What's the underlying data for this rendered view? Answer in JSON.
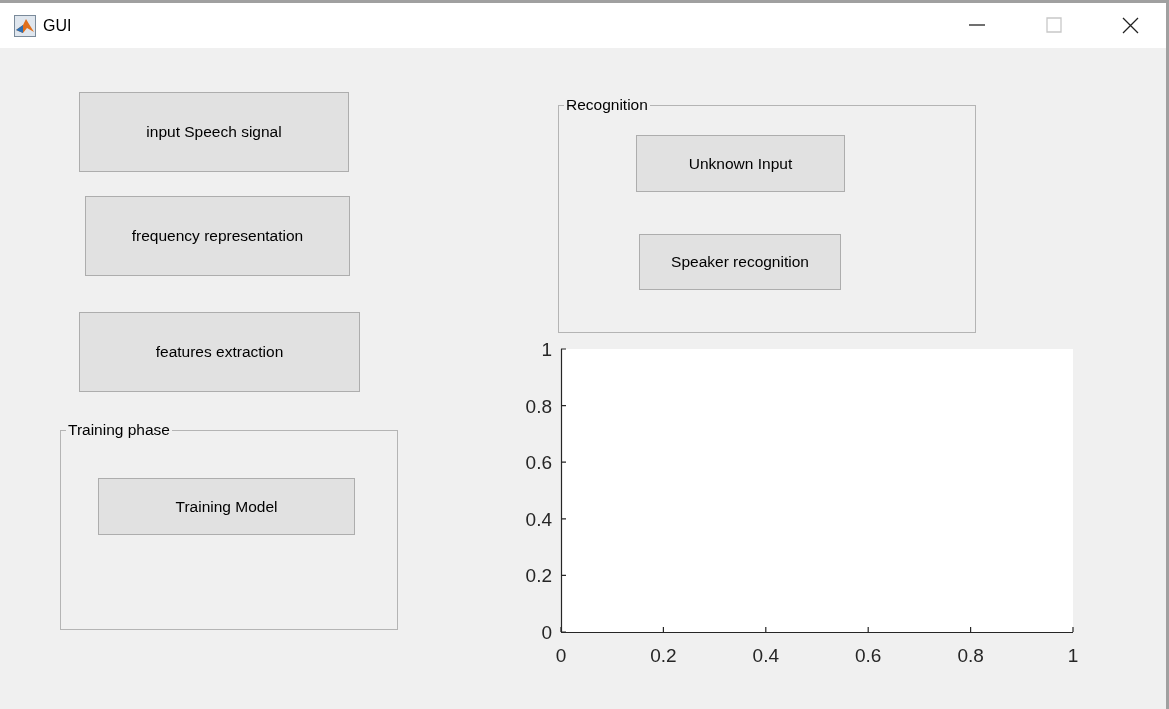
{
  "window": {
    "title": "GUI"
  },
  "buttons": [
    {
      "label": "input Speech signal"
    },
    {
      "label": "frequency representation"
    },
    {
      "label": "features extraction"
    }
  ],
  "panels": [
    {
      "title": "Training phase",
      "buttons": [
        {
          "label": "Training Model"
        }
      ]
    },
    {
      "title": "Recognition",
      "buttons": [
        {
          "label": "Unknown Input"
        },
        {
          "label": "Speaker recognition"
        }
      ]
    }
  ],
  "axes": {
    "chart_data": {
      "type": "line",
      "xlim": [
        0,
        1
      ],
      "ylim": [
        0,
        1
      ],
      "xticks": [
        0,
        {
          "value": 0.2,
          "label": "0.2"
        },
        {
          "value": 0.4,
          "label": "0.4"
        },
        {
          "value": 0.6,
          "label": "0.6"
        },
        {
          "value": 0.8,
          "label": "0.8"
        },
        1
      ],
      "yticks": [
        0,
        {
          "value": 0.2,
          "label": "0.2"
        },
        {
          "value": 0.4,
          "label": "0.4"
        },
        {
          "value": 0.6,
          "label": "0.6"
        },
        {
          "value": 0.8,
          "label": "0.8"
        },
        1
      ]
    }
  }
}
